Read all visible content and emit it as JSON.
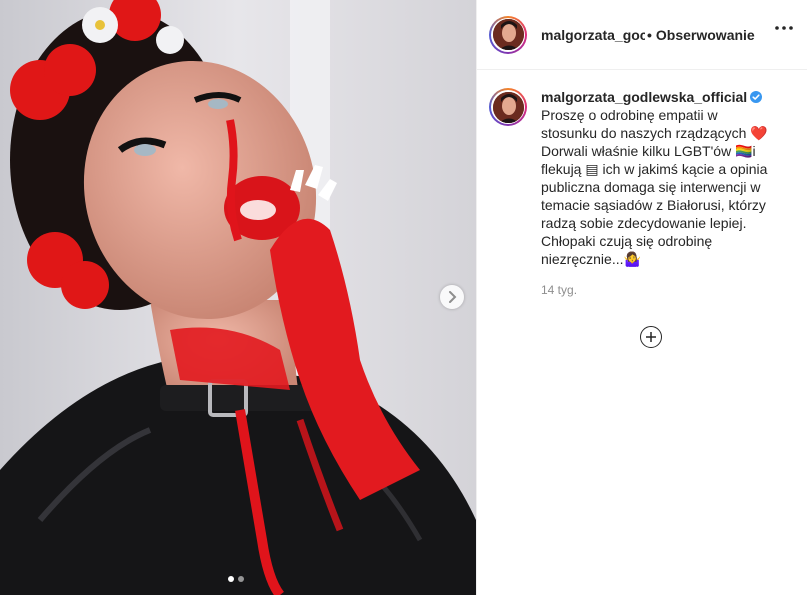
{
  "post": {
    "username": "malgorzata_godlewska_official",
    "header_username_truncated": "malgorzata_goc",
    "header_separator": "•",
    "follow_status": "Obserwowanie",
    "verified": true,
    "caption": "Proszę o odrobinę empatii w stosunku do naszych rządzących ❤️\nDorwali właśnie kilku LGBT'ów 🏳️‍🌈i flekują ▤ ich w jakimś kącie a opinia publiczna domaga się interwencji w temacie sąsiadów z Białorusi, którzy radzą sobie zdecydowanie lepiej. Chłopaki czują się odrobinę niezręcznie...🤷‍♀️",
    "timestamp": "14 tyg.",
    "carousel": {
      "slide_count": 2,
      "active_index": 0
    }
  },
  "icons": {
    "next": "chevron-right-icon",
    "more": "more-options-icon",
    "verified": "verified-badge-icon",
    "load_more": "plus-circle-icon"
  },
  "colors": {
    "verified_blue": "#3897f0",
    "text": "#262626",
    "muted": "#8e8e8e",
    "border": "#efefef"
  }
}
